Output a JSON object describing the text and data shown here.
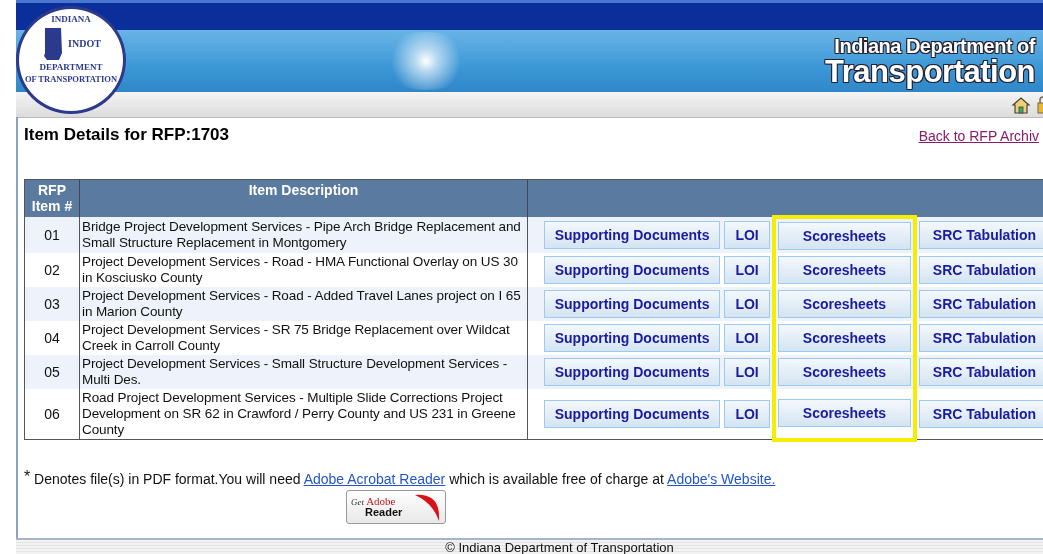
{
  "header": {
    "logo": {
      "ring_top": "INDIANA",
      "ring_left": "DEPARTMENT",
      "ring_bottom": "OF TRANSPORTATION",
      "letters": "INDOT"
    },
    "title_line1": "Indiana Department of",
    "title_line2": "Transportation"
  },
  "page": {
    "title": "Item Details for RFP:1703",
    "back_link": "Back to RFP Archiv"
  },
  "table": {
    "columns": [
      "RFP Item #",
      "Item Description"
    ],
    "rows": [
      {
        "number": "01",
        "description": "Bridge Project Development Services - Pipe Arch Bridge Replacement and Small Structure Replacement in Montgomery",
        "actions": [
          {
            "label": "Supporting Documents",
            "highlighted": false
          },
          {
            "label": "LOI",
            "highlighted": false
          },
          {
            "label": "Scoresheets",
            "highlighted": true
          },
          {
            "label": "SRC Tabulation",
            "highlighted": false
          }
        ]
      },
      {
        "number": "02",
        "description": "Project Development Services - Road - HMA Functional Overlay on US 30 in Kosciusko County",
        "actions": [
          {
            "label": "Supporting Documents",
            "highlighted": false
          },
          {
            "label": "LOI",
            "highlighted": false
          },
          {
            "label": "Scoresheets",
            "highlighted": true
          },
          {
            "label": "SRC Tabulation",
            "highlighted": false
          }
        ]
      },
      {
        "number": "03",
        "description": "Project Development Services - Road - Added Travel Lanes project on I 65 in Marion County",
        "actions": [
          {
            "label": "Supporting Documents",
            "highlighted": false
          },
          {
            "label": "LOI",
            "highlighted": false
          },
          {
            "label": "Scoresheets",
            "highlighted": true
          },
          {
            "label": "SRC Tabulation",
            "highlighted": false
          }
        ]
      },
      {
        "number": "04",
        "description": "Project Development Services - SR 75 Bridge Replacement over Wildcat Creek in Carroll County",
        "actions": [
          {
            "label": "Supporting Documents",
            "highlighted": false
          },
          {
            "label": "LOI",
            "highlighted": false
          },
          {
            "label": "Scoresheets",
            "highlighted": true
          },
          {
            "label": "SRC Tabulation",
            "highlighted": false
          }
        ]
      },
      {
        "number": "05",
        "description": "Project Development Services - Small Structure Development Services - Multi Des.",
        "actions": [
          {
            "label": "Supporting Documents",
            "highlighted": false
          },
          {
            "label": "LOI",
            "highlighted": false
          },
          {
            "label": "Scoresheets",
            "highlighted": true
          },
          {
            "label": "SRC Tabulation",
            "highlighted": false
          }
        ]
      },
      {
        "number": "06",
        "description": "Road Project Development Services - Multiple Slide Corrections Project Development on SR 62 in Crawford / Perry County and US 231 in Greene County",
        "actions": [
          {
            "label": "Supporting Documents",
            "highlighted": false
          },
          {
            "label": "LOI",
            "highlighted": false
          },
          {
            "label": "Scoresheets",
            "highlighted": true
          },
          {
            "label": "SRC Tabulation",
            "highlighted": false
          }
        ]
      }
    ]
  },
  "note": {
    "mark": "*",
    "text_before": "Denotes file(s) in PDF format.You will need",
    "link1": "Adobe Acrobat Reader",
    "text_middle": "which is available free of charge at",
    "link2": "Adobe's Website."
  },
  "adobe_badge": {
    "get": "Get",
    "brand": "Adobe",
    "product": "Reader"
  },
  "footer": {
    "copyright": "© Indiana Department of Transportation"
  }
}
